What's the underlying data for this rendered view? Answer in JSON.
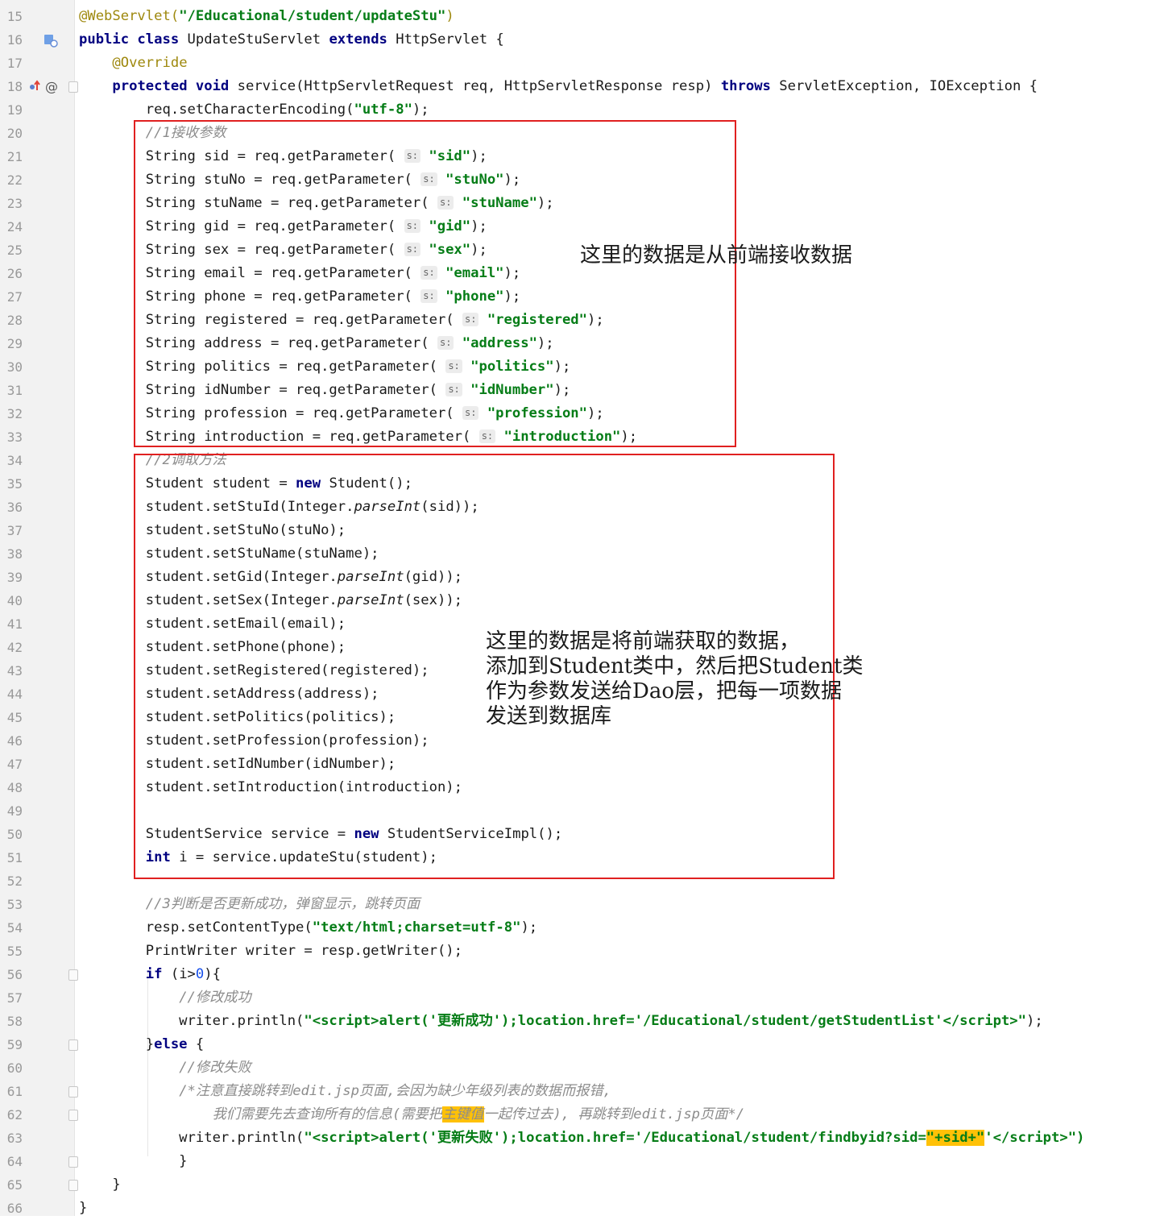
{
  "editor": {
    "gutter_icons": {
      "line16": "class-implementation-icon",
      "line18_override": "override-arrow-icon",
      "line18_at": "at-annotation-icon"
    },
    "lines": [
      {
        "n": "15",
        "h": "<span class=\"ann\">@WebServlet(</span><span class=\"str\">\"/Educational/student/updateStu\"</span><span class=\"ann\">)</span>"
      },
      {
        "n": "16",
        "h": "<span class=\"kw\">public class</span> UpdateStuServlet <span class=\"kw\">extends</span> HttpServlet {"
      },
      {
        "n": "17",
        "h": "    <span class=\"ann\">@Override</span>"
      },
      {
        "n": "18",
        "h": "    <span class=\"kw\">protected void</span> service(HttpServletRequest req, HttpServletResponse resp) <span class=\"kw\">throws</span> ServletException, IOException {"
      },
      {
        "n": "19",
        "h": "        req.setCharacterEncoding(<span class=\"str\">\"utf-8\"</span>);"
      },
      {
        "n": "20",
        "h": "        <span class=\"cm\">//1接收参数</span>"
      },
      {
        "n": "21",
        "h": "        String sid = req.getParameter( <span class=\"hint\">s:</span> <span class=\"str\">\"sid\"</span>);"
      },
      {
        "n": "22",
        "h": "        String stuNo = req.getParameter( <span class=\"hint\">s:</span> <span class=\"str\">\"stuNo\"</span>);"
      },
      {
        "n": "23",
        "h": "        String stuName = req.getParameter( <span class=\"hint\">s:</span> <span class=\"str\">\"stuName\"</span>);"
      },
      {
        "n": "24",
        "h": "        String gid = req.getParameter( <span class=\"hint\">s:</span> <span class=\"str\">\"gid\"</span>);"
      },
      {
        "n": "25",
        "h": "        String sex = req.getParameter( <span class=\"hint\">s:</span> <span class=\"str\">\"sex\"</span>);"
      },
      {
        "n": "26",
        "h": "        String email = req.getParameter( <span class=\"hint\">s:</span> <span class=\"str\">\"email\"</span>);"
      },
      {
        "n": "27",
        "h": "        String phone = req.getParameter( <span class=\"hint\">s:</span> <span class=\"str\">\"phone\"</span>);"
      },
      {
        "n": "28",
        "h": "        String registered = req.getParameter( <span class=\"hint\">s:</span> <span class=\"str\">\"registered\"</span>);"
      },
      {
        "n": "29",
        "h": "        String address = req.getParameter( <span class=\"hint\">s:</span> <span class=\"str\">\"address\"</span>);"
      },
      {
        "n": "30",
        "h": "        String politics = req.getParameter( <span class=\"hint\">s:</span> <span class=\"str\">\"politics\"</span>);"
      },
      {
        "n": "31",
        "h": "        String idNumber = req.getParameter( <span class=\"hint\">s:</span> <span class=\"str\">\"idNumber\"</span>);"
      },
      {
        "n": "32",
        "h": "        String profession = req.getParameter( <span class=\"hint\">s:</span> <span class=\"str\">\"profession\"</span>);"
      },
      {
        "n": "33",
        "h": "        String introduction = req.getParameter( <span class=\"hint\">s:</span> <span class=\"str\">\"introduction\"</span>);"
      },
      {
        "n": "34",
        "h": "        <span class=\"cm\">//2调取方法</span>"
      },
      {
        "n": "35",
        "h": "        Student student = <span class=\"kw\">new</span> Student();"
      },
      {
        "n": "36",
        "h": "        student.setStuId(Integer.<span class=\"it\">parseInt</span>(sid));"
      },
      {
        "n": "37",
        "h": "        student.setStuNo(stuNo);"
      },
      {
        "n": "38",
        "h": "        student.setStuName(stuName);"
      },
      {
        "n": "39",
        "h": "        student.setGid(Integer.<span class=\"it\">parseInt</span>(gid));"
      },
      {
        "n": "40",
        "h": "        student.setSex(Integer.<span class=\"it\">parseInt</span>(sex));"
      },
      {
        "n": "41",
        "h": "        student.setEmail(email);"
      },
      {
        "n": "42",
        "h": "        student.setPhone(phone);"
      },
      {
        "n": "43",
        "h": "        student.setRegistered(registered);"
      },
      {
        "n": "44",
        "h": "        student.setAddress(address);"
      },
      {
        "n": "45",
        "h": "        student.setPolitics(politics);"
      },
      {
        "n": "46",
        "h": "        student.setProfession(profession);"
      },
      {
        "n": "47",
        "h": "        student.setIdNumber(idNumber);"
      },
      {
        "n": "48",
        "h": "        student.setIntroduction(introduction);"
      },
      {
        "n": "49",
        "h": ""
      },
      {
        "n": "50",
        "h": "        StudentService service = <span class=\"kw\">new</span> StudentServiceImpl();"
      },
      {
        "n": "51",
        "h": "        <span class=\"kw\">int</span> i = service.updateStu(student);"
      },
      {
        "n": "52",
        "h": ""
      },
      {
        "n": "53",
        "h": "        <span class=\"cm\">//3判断是否更新成功，弹窗显示，跳转页面</span>"
      },
      {
        "n": "54",
        "h": "        resp.setContentType(<span class=\"str\">\"text/html;charset=utf-8\"</span>);"
      },
      {
        "n": "55",
        "h": "        PrintWriter writer = resp.getWriter();"
      },
      {
        "n": "56",
        "h": "        <span class=\"kw\">if</span> (i&gt;<span class=\"num\">0</span>){"
      },
      {
        "n": "57",
        "h": "            <span class=\"cm\">//修改成功</span>"
      },
      {
        "n": "58",
        "h": "            writer.println(<span class=\"str\">\"&lt;script&gt;alert('更新成功');location.href='/Educational/student/getStudentList'&lt;/script&gt;\"</span>);"
      },
      {
        "n": "59",
        "h": "        }<span class=\"kw\">else</span> {"
      },
      {
        "n": "60",
        "h": "            <span class=\"cm\">//修改失败</span>"
      },
      {
        "n": "61",
        "h": "            <span class=\"cm\">/*注意直接跳转到edit.jsp页面,会因为缺少年级列表的数据而报错,</span>"
      },
      {
        "n": "62",
        "h": "<span class=\"cm\">                我们需要先去查询所有的信息(需要把<span class=\"hl\">主键值</span>一起传过去), 再跳转到edit.jsp页面*/</span>"
      },
      {
        "n": "63",
        "h": "            writer.println(<span class=\"str\">\"&lt;script&gt;alert('更新失败');location.href='/Educational/student/findbyid?sid=<span class=\"hl\">\"+sid+\"</span>'&lt;/script&gt;\")</span>"
      },
      {
        "n": "64",
        "h": "            }"
      },
      {
        "n": "65",
        "h": "    }"
      },
      {
        "n": "66",
        "h": "}"
      }
    ]
  },
  "annotations": {
    "note1": "这里的数据是从前端接收数据",
    "note2": "这里的数据是将前端获取的数据，\n添加到Student类中，然后把Student类\n作为参数发送给Dao层，把每一项数据\n发送到数据库",
    "box_color": "#e02020"
  },
  "colors": {
    "keyword": "#000080",
    "string": "#067d17",
    "annotation": "#9e880d",
    "comment": "#8c8c8c",
    "highlight": "#ffc107"
  }
}
